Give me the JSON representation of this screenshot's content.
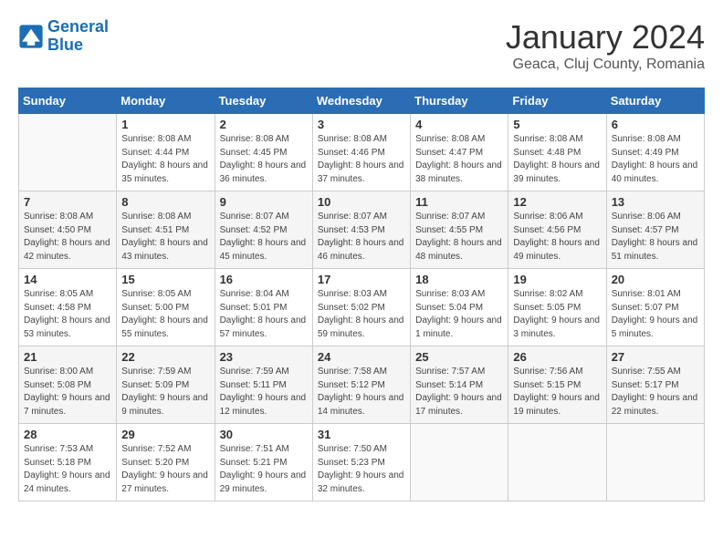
{
  "logo": {
    "line1": "General",
    "line2": "Blue"
  },
  "title": "January 2024",
  "location": "Geaca, Cluj County, Romania",
  "days_header": [
    "Sunday",
    "Monday",
    "Tuesday",
    "Wednesday",
    "Thursday",
    "Friday",
    "Saturday"
  ],
  "weeks": [
    [
      {
        "num": "",
        "sunrise": "",
        "sunset": "",
        "daylight": ""
      },
      {
        "num": "1",
        "sunrise": "Sunrise: 8:08 AM",
        "sunset": "Sunset: 4:44 PM",
        "daylight": "Daylight: 8 hours and 35 minutes."
      },
      {
        "num": "2",
        "sunrise": "Sunrise: 8:08 AM",
        "sunset": "Sunset: 4:45 PM",
        "daylight": "Daylight: 8 hours and 36 minutes."
      },
      {
        "num": "3",
        "sunrise": "Sunrise: 8:08 AM",
        "sunset": "Sunset: 4:46 PM",
        "daylight": "Daylight: 8 hours and 37 minutes."
      },
      {
        "num": "4",
        "sunrise": "Sunrise: 8:08 AM",
        "sunset": "Sunset: 4:47 PM",
        "daylight": "Daylight: 8 hours and 38 minutes."
      },
      {
        "num": "5",
        "sunrise": "Sunrise: 8:08 AM",
        "sunset": "Sunset: 4:48 PM",
        "daylight": "Daylight: 8 hours and 39 minutes."
      },
      {
        "num": "6",
        "sunrise": "Sunrise: 8:08 AM",
        "sunset": "Sunset: 4:49 PM",
        "daylight": "Daylight: 8 hours and 40 minutes."
      }
    ],
    [
      {
        "num": "7",
        "sunrise": "Sunrise: 8:08 AM",
        "sunset": "Sunset: 4:50 PM",
        "daylight": "Daylight: 8 hours and 42 minutes."
      },
      {
        "num": "8",
        "sunrise": "Sunrise: 8:08 AM",
        "sunset": "Sunset: 4:51 PM",
        "daylight": "Daylight: 8 hours and 43 minutes."
      },
      {
        "num": "9",
        "sunrise": "Sunrise: 8:07 AM",
        "sunset": "Sunset: 4:52 PM",
        "daylight": "Daylight: 8 hours and 45 minutes."
      },
      {
        "num": "10",
        "sunrise": "Sunrise: 8:07 AM",
        "sunset": "Sunset: 4:53 PM",
        "daylight": "Daylight: 8 hours and 46 minutes."
      },
      {
        "num": "11",
        "sunrise": "Sunrise: 8:07 AM",
        "sunset": "Sunset: 4:55 PM",
        "daylight": "Daylight: 8 hours and 48 minutes."
      },
      {
        "num": "12",
        "sunrise": "Sunrise: 8:06 AM",
        "sunset": "Sunset: 4:56 PM",
        "daylight": "Daylight: 8 hours and 49 minutes."
      },
      {
        "num": "13",
        "sunrise": "Sunrise: 8:06 AM",
        "sunset": "Sunset: 4:57 PM",
        "daylight": "Daylight: 8 hours and 51 minutes."
      }
    ],
    [
      {
        "num": "14",
        "sunrise": "Sunrise: 8:05 AM",
        "sunset": "Sunset: 4:58 PM",
        "daylight": "Daylight: 8 hours and 53 minutes."
      },
      {
        "num": "15",
        "sunrise": "Sunrise: 8:05 AM",
        "sunset": "Sunset: 5:00 PM",
        "daylight": "Daylight: 8 hours and 55 minutes."
      },
      {
        "num": "16",
        "sunrise": "Sunrise: 8:04 AM",
        "sunset": "Sunset: 5:01 PM",
        "daylight": "Daylight: 8 hours and 57 minutes."
      },
      {
        "num": "17",
        "sunrise": "Sunrise: 8:03 AM",
        "sunset": "Sunset: 5:02 PM",
        "daylight": "Daylight: 8 hours and 59 minutes."
      },
      {
        "num": "18",
        "sunrise": "Sunrise: 8:03 AM",
        "sunset": "Sunset: 5:04 PM",
        "daylight": "Daylight: 9 hours and 1 minute."
      },
      {
        "num": "19",
        "sunrise": "Sunrise: 8:02 AM",
        "sunset": "Sunset: 5:05 PM",
        "daylight": "Daylight: 9 hours and 3 minutes."
      },
      {
        "num": "20",
        "sunrise": "Sunrise: 8:01 AM",
        "sunset": "Sunset: 5:07 PM",
        "daylight": "Daylight: 9 hours and 5 minutes."
      }
    ],
    [
      {
        "num": "21",
        "sunrise": "Sunrise: 8:00 AM",
        "sunset": "Sunset: 5:08 PM",
        "daylight": "Daylight: 9 hours and 7 minutes."
      },
      {
        "num": "22",
        "sunrise": "Sunrise: 7:59 AM",
        "sunset": "Sunset: 5:09 PM",
        "daylight": "Daylight: 9 hours and 9 minutes."
      },
      {
        "num": "23",
        "sunrise": "Sunrise: 7:59 AM",
        "sunset": "Sunset: 5:11 PM",
        "daylight": "Daylight: 9 hours and 12 minutes."
      },
      {
        "num": "24",
        "sunrise": "Sunrise: 7:58 AM",
        "sunset": "Sunset: 5:12 PM",
        "daylight": "Daylight: 9 hours and 14 minutes."
      },
      {
        "num": "25",
        "sunrise": "Sunrise: 7:57 AM",
        "sunset": "Sunset: 5:14 PM",
        "daylight": "Daylight: 9 hours and 17 minutes."
      },
      {
        "num": "26",
        "sunrise": "Sunrise: 7:56 AM",
        "sunset": "Sunset: 5:15 PM",
        "daylight": "Daylight: 9 hours and 19 minutes."
      },
      {
        "num": "27",
        "sunrise": "Sunrise: 7:55 AM",
        "sunset": "Sunset: 5:17 PM",
        "daylight": "Daylight: 9 hours and 22 minutes."
      }
    ],
    [
      {
        "num": "28",
        "sunrise": "Sunrise: 7:53 AM",
        "sunset": "Sunset: 5:18 PM",
        "daylight": "Daylight: 9 hours and 24 minutes."
      },
      {
        "num": "29",
        "sunrise": "Sunrise: 7:52 AM",
        "sunset": "Sunset: 5:20 PM",
        "daylight": "Daylight: 9 hours and 27 minutes."
      },
      {
        "num": "30",
        "sunrise": "Sunrise: 7:51 AM",
        "sunset": "Sunset: 5:21 PM",
        "daylight": "Daylight: 9 hours and 29 minutes."
      },
      {
        "num": "31",
        "sunrise": "Sunrise: 7:50 AM",
        "sunset": "Sunset: 5:23 PM",
        "daylight": "Daylight: 9 hours and 32 minutes."
      },
      {
        "num": "",
        "sunrise": "",
        "sunset": "",
        "daylight": ""
      },
      {
        "num": "",
        "sunrise": "",
        "sunset": "",
        "daylight": ""
      },
      {
        "num": "",
        "sunrise": "",
        "sunset": "",
        "daylight": ""
      }
    ]
  ]
}
